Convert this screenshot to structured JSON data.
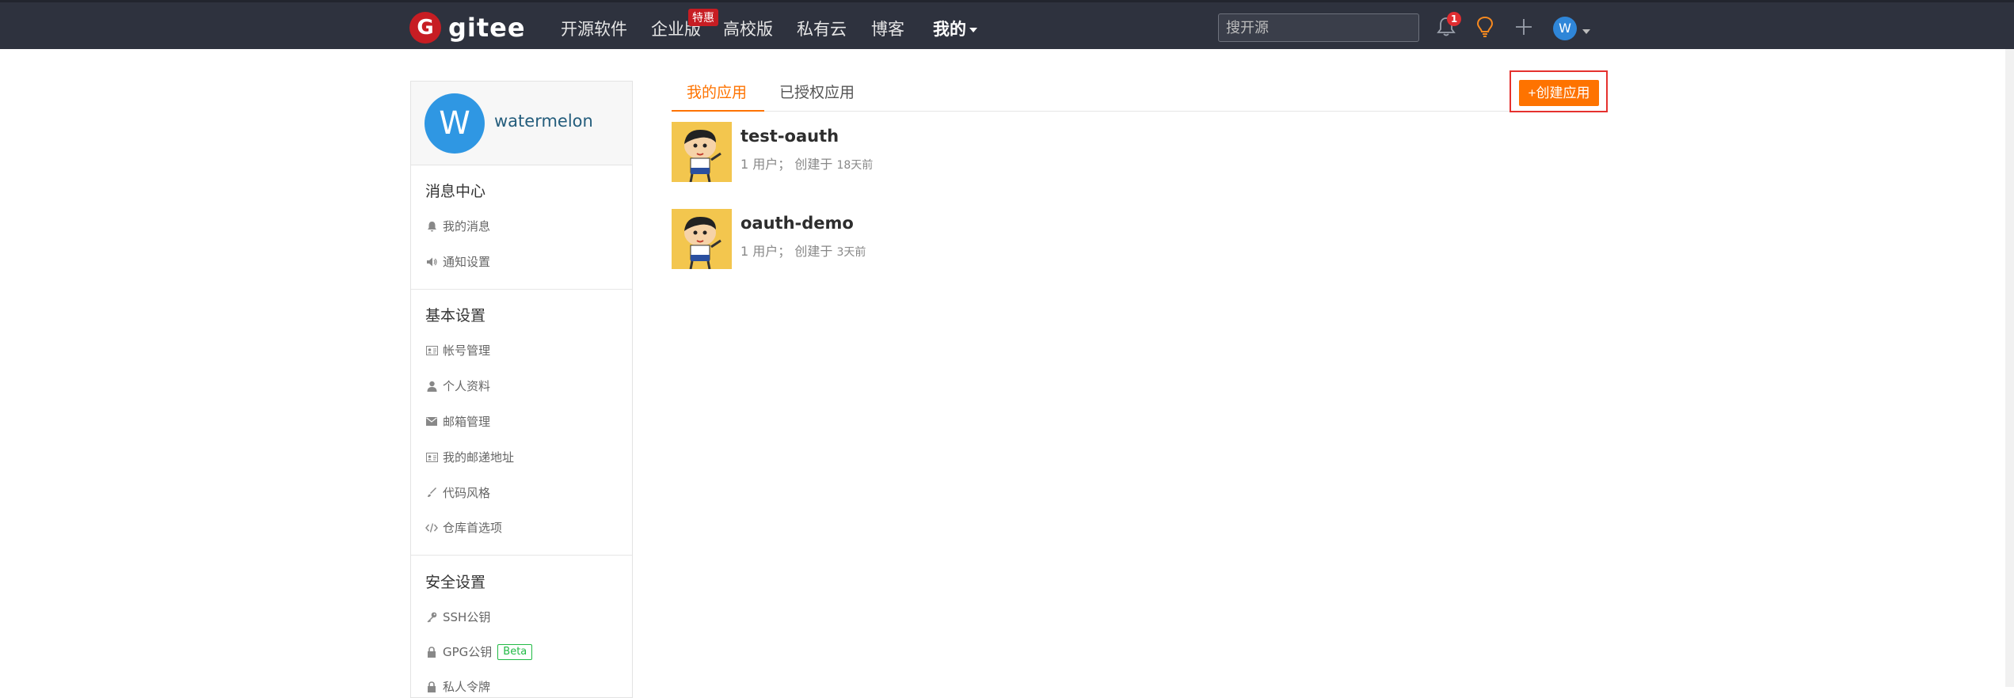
{
  "brand": {
    "mark": "G",
    "name": "gitee"
  },
  "nav": {
    "items": [
      "开源软件",
      "企业版",
      "高校版",
      "私有云",
      "博客"
    ],
    "promo_badge": "特惠",
    "mine": "我的"
  },
  "search": {
    "placeholder": "搜开源"
  },
  "header_actions": {
    "notification_count": "1",
    "avatar_letter": "W"
  },
  "profile": {
    "avatar_letter": "W",
    "username": "watermelon"
  },
  "sidebar": {
    "message_center": {
      "title": "消息中心",
      "items": [
        {
          "label": "我的消息",
          "icon": "bell-icon"
        },
        {
          "label": "通知设置",
          "icon": "volume-icon"
        }
      ]
    },
    "basic_settings": {
      "title": "基本设置",
      "items": [
        {
          "label": "帐号管理",
          "icon": "id-card-icon"
        },
        {
          "label": "个人资料",
          "icon": "user-icon"
        },
        {
          "label": "邮箱管理",
          "icon": "envelope-icon"
        },
        {
          "label": "我的邮递地址",
          "icon": "address-card-icon"
        },
        {
          "label": "代码风格",
          "icon": "brush-icon"
        },
        {
          "label": "仓库首选项",
          "icon": "code-icon"
        }
      ]
    },
    "security_settings": {
      "title": "安全设置",
      "items": [
        {
          "label": "SSH公钥",
          "icon": "key-icon"
        },
        {
          "label": "GPG公钥",
          "icon": "lock-icon",
          "badge": "Beta"
        },
        {
          "label": "私人令牌",
          "icon": "lock-icon"
        }
      ]
    }
  },
  "tabs": [
    {
      "label": "我的应用",
      "active": true
    },
    {
      "label": "已授权应用",
      "active": false
    }
  ],
  "create_button": "+创建应用",
  "apps": [
    {
      "name": "test-oauth",
      "meta": "1 用户；  创建于 ",
      "ago": "18天前"
    },
    {
      "name": "oauth-demo",
      "meta": "1 用户；  创建于 ",
      "ago": "3天前"
    }
  ],
  "colors": {
    "accent": "#fe7300",
    "topbar": "#2e323e",
    "brand_red": "#c71d23",
    "highlight_box": "#e5312e"
  }
}
